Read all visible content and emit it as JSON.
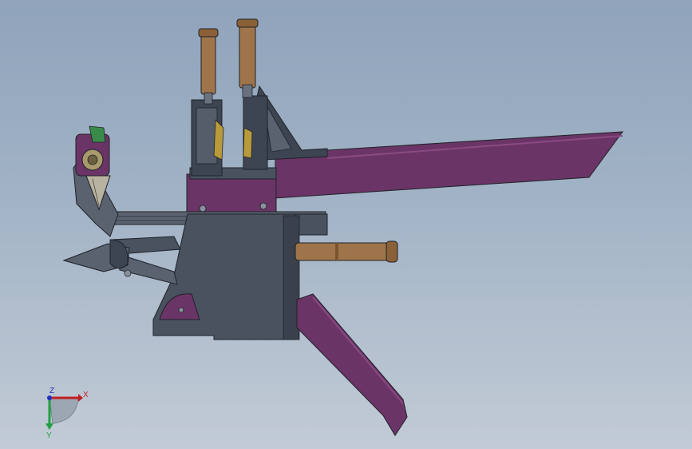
{
  "viewport": {
    "model": "pneumatic-clamp-assembly",
    "colors": {
      "background_top": "#8fa3bb",
      "background_bottom": "#c2cbd6",
      "purple": "#6b3466",
      "purple_light": "#8a4a84",
      "steel": "#4a5260",
      "steel_light": "#6a7280",
      "bronze": "#a0744a",
      "outline": "#1e2228"
    }
  },
  "triad": {
    "x_label": "X",
    "y_label": "Y",
    "z_label": "Z",
    "colors": {
      "x": "#c02020",
      "y": "#20a040",
      "z": "#2030c0"
    }
  }
}
